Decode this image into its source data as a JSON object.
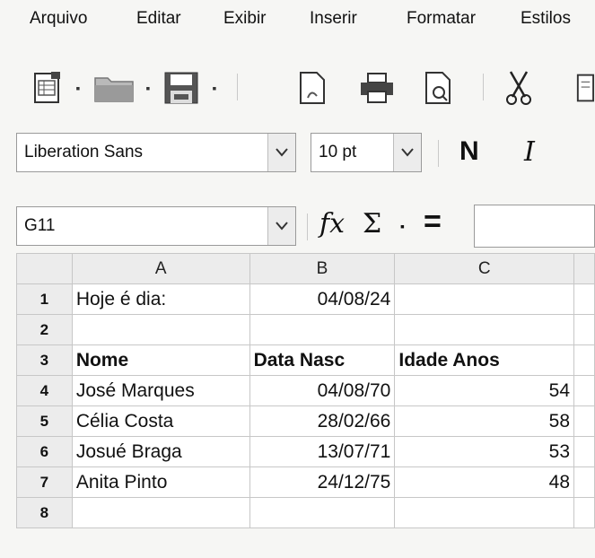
{
  "menu": {
    "items": [
      "Arquivo",
      "Editar",
      "Exibir",
      "Inserir",
      "Formatar",
      "Estilos"
    ]
  },
  "toolbar": {
    "icons": [
      "new-document-icon",
      "open-folder-icon",
      "save-icon",
      "export-pdf-icon",
      "print-icon",
      "print-preview-icon",
      "cut-icon",
      "copy-icon"
    ]
  },
  "font_bar": {
    "font_name": "Liberation Sans",
    "font_size": "10 pt",
    "bold_label": "N",
    "italic_label": "I"
  },
  "formula_bar": {
    "name_box": "G11",
    "fx_label": "fx",
    "sum_label": "Σ",
    "equals_label": "=",
    "formula_value": ""
  },
  "sheet": {
    "columns": [
      "A",
      "B",
      "C"
    ],
    "rows": [
      {
        "num": "1",
        "a": "Hoje é dia:",
        "b": "04/08/24",
        "c": ""
      },
      {
        "num": "2",
        "a": "",
        "b": "",
        "c": ""
      },
      {
        "num": "3",
        "a": "Nome",
        "b": "Data Nasc",
        "c": "Idade Anos"
      },
      {
        "num": "4",
        "a": "José Marques",
        "b": "04/08/70",
        "c": "54"
      },
      {
        "num": "5",
        "a": "Célia Costa",
        "b": "28/02/66",
        "c": "58"
      },
      {
        "num": "6",
        "a": "Josué Braga",
        "b": "13/07/71",
        "c": "53"
      },
      {
        "num": "7",
        "a": "Anita Pinto",
        "b": "24/12/75",
        "c": "48"
      },
      {
        "num": "8",
        "a": "",
        "b": "",
        "c": ""
      }
    ]
  }
}
